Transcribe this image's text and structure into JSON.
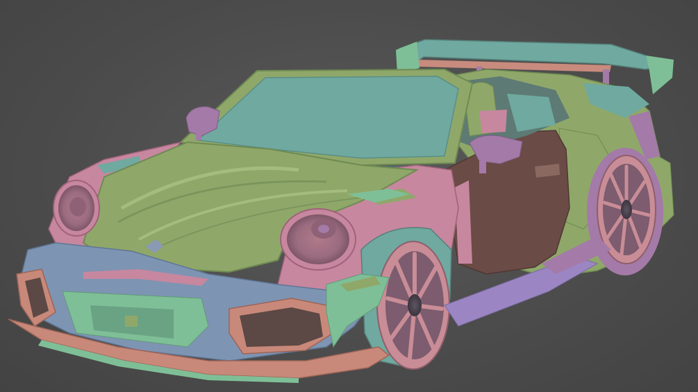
{
  "viewport": {
    "background": "#4b4b4b"
  },
  "model": {
    "palette": {
      "green": "#8fa86a",
      "green_dark": "#6f8a52",
      "teal": "#6fa9a0",
      "teal_light": "#80bdb3",
      "pink": "#c7879f",
      "mauve": "#a47aa8",
      "purple": "#9b86c3",
      "brown": "#6a4b45",
      "salmon": "#c8897a",
      "wheel_pink": "#c98d97",
      "blue_grey": "#7e94b3",
      "mint": "#7fbf97"
    }
  }
}
